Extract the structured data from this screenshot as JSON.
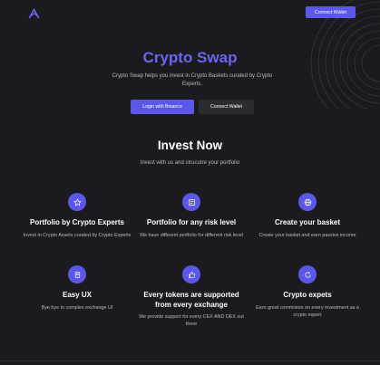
{
  "header": {
    "logo_icon": "crypto-swap-logo-icon",
    "connect_wallet_label": "Connect Wallet"
  },
  "hero": {
    "title": "Crypto Swap",
    "subtitle": "Crypto Swap helps you invest in Crypto Baskets curated by Crypto Experts.",
    "login_binance_label": "Login with Binance",
    "connect_wallet_label": "Connect Wallet"
  },
  "invest": {
    "title": "Invest Now",
    "subtitle": "Invest with us and strucutre your portfolio"
  },
  "features": [
    {
      "icon": "star-icon",
      "title": "Portfolio by Crypto Experts",
      "description": "Invest in Crypto Assets curated by Crypto Experts"
    },
    {
      "icon": "document-icon",
      "title": "Portfolio for any risk level",
      "description": "We have different portfolio for different risk level"
    },
    {
      "icon": "globe-icon",
      "title": "Create your basket",
      "description": "Create your basket and earn passive income"
    },
    {
      "icon": "badge-icon",
      "title": "Easy UX",
      "description": "Bye bye to complex exchange UI"
    },
    {
      "icon": "thumbs-up-icon",
      "title": "Every tokens are supported from every exchange",
      "description": "We provide support for every CEX AND DEX out there"
    },
    {
      "icon": "refresh-icon",
      "title": "Crypto expets",
      "description": "Earn great commision on every investment as a crypto expert"
    }
  ],
  "colors": {
    "background": "#1b1b1f",
    "accent": "#5b57e8",
    "title_accent": "#6d63f0",
    "secondary_button": "#2c2c30",
    "muted_text": "#b9b9c0"
  }
}
